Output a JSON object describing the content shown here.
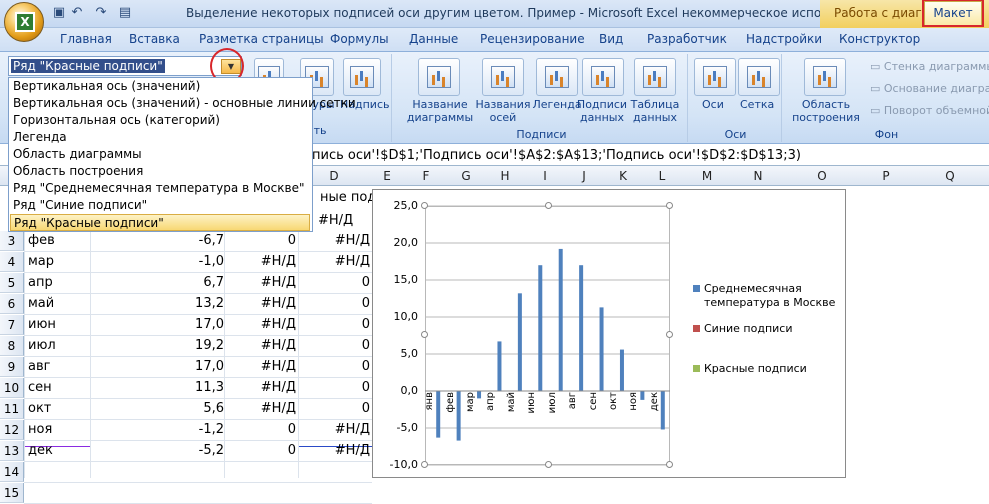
{
  "window": {
    "title": "Выделение некоторых подписей оси другим цветом. Пример - Microsoft Excel некоммерческое использован...",
    "context_tab": "Работа с диаграммами"
  },
  "tabs": [
    "Главная",
    "Вставка",
    "Разметка страницы",
    "Формулы",
    "Данные",
    "Рецензирование",
    "Вид",
    "Разработчик",
    "Надстройки",
    "Конструктор",
    "Макет"
  ],
  "ribbon": {
    "selector_value": "Ряд \"Красные подписи\"",
    "insert_label_fragment": "вить",
    "insert_buttons": [
      "туры",
      "Надпись"
    ],
    "labels_group": "Подписи",
    "labels_buttons": [
      "Название\nдиаграммы",
      "Названия\nосей",
      "Легенда",
      "Подписи\nданных",
      "Таблица\nданных"
    ],
    "axes_group": "Оси",
    "axes_buttons": [
      "Оси",
      "Сетка"
    ],
    "bg_group": "Фон",
    "bg_button": "Область\nпостроения",
    "bg_side": [
      "Стенка диаграммы",
      "Основание диаграм",
      "Поворот объемной"
    ]
  },
  "dropdown": [
    "Вертикальная ось (значений)",
    "Вертикальная ось (значений)  - основные линии сетки",
    "Горизонтальная ось (категорий)",
    "Легенда",
    "Область диаграммы",
    "Область построения",
    "Ряд \"Среднемесячная температура в Москве\"",
    "Ряд \"Синие подписи\"",
    "Ряд \"Красные подписи\""
  ],
  "formula_text": "пись оси'!$D$1;'Подпись оси'!$A$2:$A$13;'Подпись оси'!$D$2:$D$13;3)",
  "columns": [
    "D",
    "E",
    "F",
    "G",
    "H",
    "I",
    "J",
    "K",
    "L",
    "M",
    "N",
    "O",
    "P",
    "Q"
  ],
  "header_fragment": "ные подпи",
  "rows": [
    {
      "n": "3",
      "a": "фев",
      "b": "-6,7",
      "c": "0",
      "d": "#Н/Д"
    },
    {
      "n": "4",
      "a": "мар",
      "b": "-1,0",
      "c": "#Н/Д",
      "d": "#Н/Д"
    },
    {
      "n": "5",
      "a": "апр",
      "b": "6,7",
      "c": "#Н/Д",
      "d": "0"
    },
    {
      "n": "6",
      "a": "май",
      "b": "13,2",
      "c": "#Н/Д",
      "d": "0"
    },
    {
      "n": "7",
      "a": "июн",
      "b": "17,0",
      "c": "#Н/Д",
      "d": "0"
    },
    {
      "n": "8",
      "a": "июл",
      "b": "19,2",
      "c": "#Н/Д",
      "d": "0"
    },
    {
      "n": "9",
      "a": "авг",
      "b": "17,0",
      "c": "#Н/Д",
      "d": "0"
    },
    {
      "n": "10",
      "a": "сен",
      "b": "11,3",
      "c": "#Н/Д",
      "d": "0"
    },
    {
      "n": "11",
      "a": "окт",
      "b": "5,6",
      "c": "#Н/Д",
      "d": "0"
    },
    {
      "n": "12",
      "a": "ноя",
      "b": "-1,2",
      "c": "0",
      "d": "#Н/Д"
    },
    {
      "n": "13",
      "a": "дек",
      "b": "-5,2",
      "c": "0",
      "d": "#Н/Д"
    },
    {
      "n": "14",
      "a": "",
      "b": "",
      "c": "",
      "d": ""
    },
    {
      "n": "15",
      "a": "",
      "b": "",
      "c": "",
      "d": ""
    }
  ],
  "row2_d": "#Н/Д",
  "colors": {
    "accent_red": "#d8262b",
    "series_blue": "#4f81bd",
    "series_red": "#c0504d",
    "series_green": "#9bbb59"
  },
  "chart_data": {
    "type": "bar",
    "categories": [
      "янв",
      "фев",
      "мар",
      "апр",
      "май",
      "июн",
      "июл",
      "авг",
      "сен",
      "окт",
      "ноя",
      "дек"
    ],
    "series": [
      {
        "name": "Среднемесячная температура в Москве",
        "values": [
          -6.3,
          -6.7,
          -1.0,
          6.7,
          13.2,
          17.0,
          19.2,
          17.0,
          11.3,
          5.6,
          -1.2,
          -5.2
        ]
      },
      {
        "name": "Синие подписи",
        "values": []
      },
      {
        "name": "Красные подписи",
        "values": []
      }
    ],
    "yticks": [
      "25,0",
      "20,0",
      "15,0",
      "10,0",
      "5,0",
      "0,0",
      "-5,0",
      "-10,0"
    ],
    "ylim": [
      -10,
      25
    ],
    "grid": true,
    "legend": "right"
  }
}
